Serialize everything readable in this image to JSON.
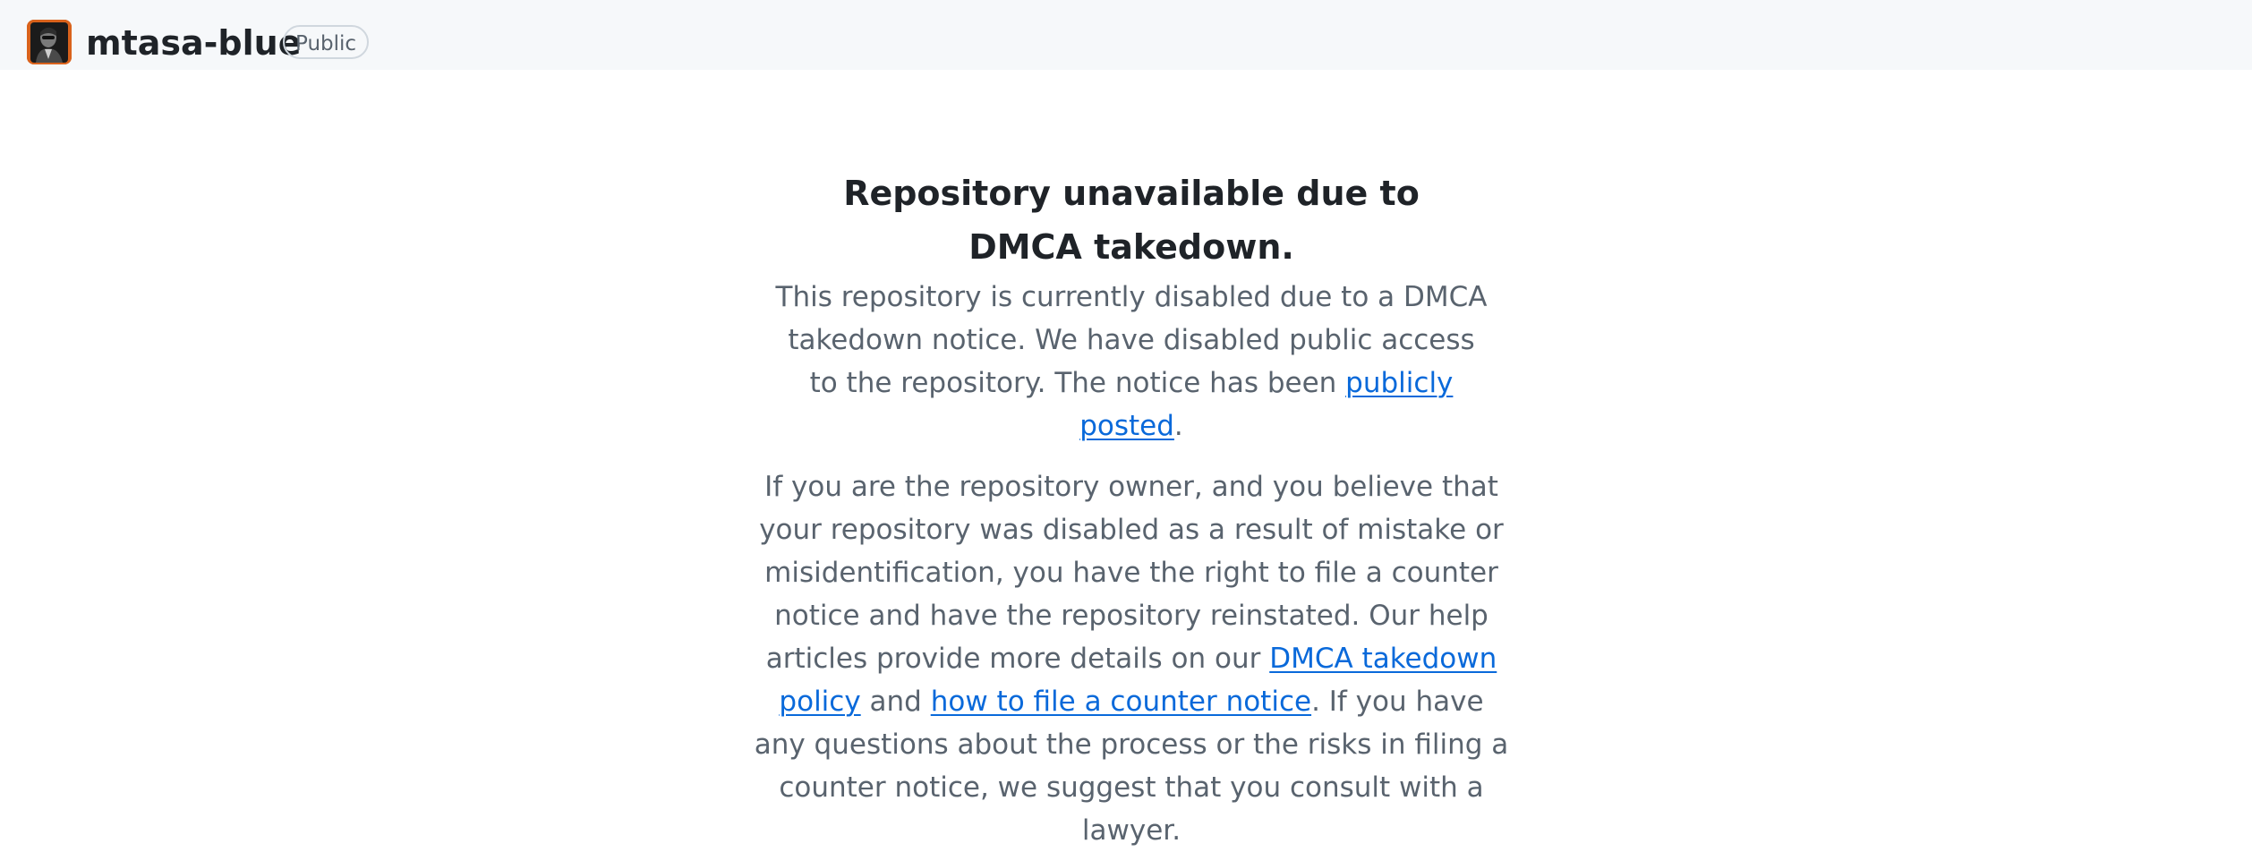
{
  "header": {
    "repo_name": "mtasa-blue",
    "visibility": "Public",
    "avatar_icon": "org-avatar-icon",
    "background_color": "#f6f8fa"
  },
  "notice": {
    "title": "Repository unavailable due to DMCA takedown.",
    "para1": {
      "text_before": "This repository is currently disabled due to a DMCA takedown notice. We have disabled public access to the repository. The notice has been ",
      "link": "publicly posted",
      "text_after": "."
    },
    "para2": {
      "text_1": "If you are the repository owner, and you believe that your repository was disabled as a result of mistake or misidentification, you have the right to file a counter notice and have the repository reinstated. Our help articles provide more details on our ",
      "link_1": "DMCA takedown policy",
      "text_2": " and ",
      "link_2": "how to file a counter notice",
      "text_3": ". If you have any questions about the process or the risks in filing a counter notice, we suggest that you consult with a lawyer."
    }
  },
  "colors": {
    "link": "#0969da",
    "muted_text": "#59636e",
    "heading_text": "#1f2328"
  }
}
